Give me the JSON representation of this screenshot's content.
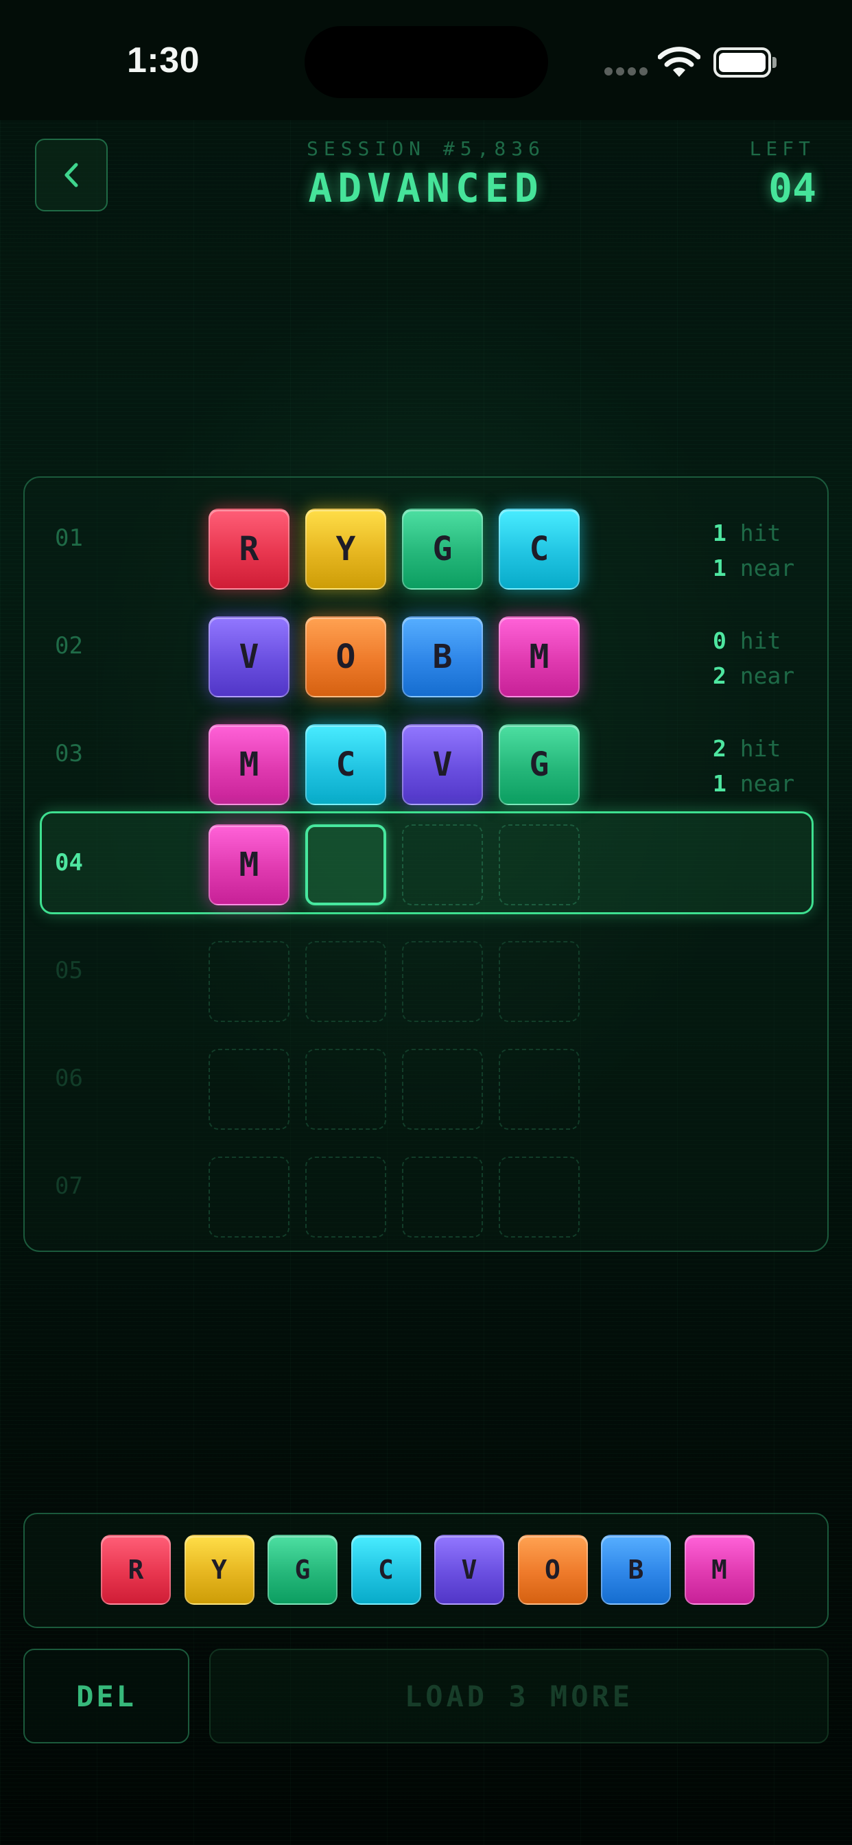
{
  "status_bar": {
    "time": "1:30",
    "wifi_icon": "wifi-icon",
    "battery_icon": "battery-full-icon",
    "battery_level": 1.0
  },
  "header": {
    "back_icon": "chevron-left-icon",
    "back_glyph": "‹",
    "session_label": "SESSION #5,836",
    "mode_title": "ADVANCED",
    "left_label": "LEFT",
    "left_value": "04"
  },
  "colors": {
    "R": "#e8364f",
    "Y": "#e6b620",
    "G": "#25b77a",
    "C": "#21c4e2",
    "V": "#6a4fe0",
    "O": "#ee7a2a",
    "B": "#2e86e8",
    "M": "#e03ab0",
    "accent": "#46e49a"
  },
  "board": {
    "rows": [
      {
        "number": "01",
        "pegs": [
          "R",
          "Y",
          "G",
          "C"
        ],
        "hits": "1",
        "hit_label": "hit",
        "nears": "1",
        "near_label": "near",
        "state": "scored"
      },
      {
        "number": "02",
        "pegs": [
          "V",
          "O",
          "B",
          "M"
        ],
        "hits": "0",
        "hit_label": "hit",
        "nears": "2",
        "near_label": "near",
        "state": "scored"
      },
      {
        "number": "03",
        "pegs": [
          "M",
          "C",
          "V",
          "G"
        ],
        "hits": "2",
        "hit_label": "hit",
        "nears": "1",
        "near_label": "near",
        "state": "scored"
      },
      {
        "number": "04",
        "pegs": [
          "M",
          "",
          "",
          ""
        ],
        "state": "current",
        "cursor_slot": 1
      },
      {
        "number": "05",
        "pegs": [
          "",
          "",
          "",
          ""
        ],
        "state": "future"
      },
      {
        "number": "06",
        "pegs": [
          "",
          "",
          "",
          ""
        ],
        "state": "future"
      },
      {
        "number": "07",
        "pegs": [
          "",
          "",
          "",
          ""
        ],
        "state": "future"
      }
    ]
  },
  "palette": {
    "colors": [
      "R",
      "Y",
      "G",
      "C",
      "V",
      "O",
      "B",
      "M"
    ]
  },
  "actions": {
    "delete_label": "DEL",
    "load_more_label": "LOAD 3 MORE",
    "load_more_enabled": false
  }
}
